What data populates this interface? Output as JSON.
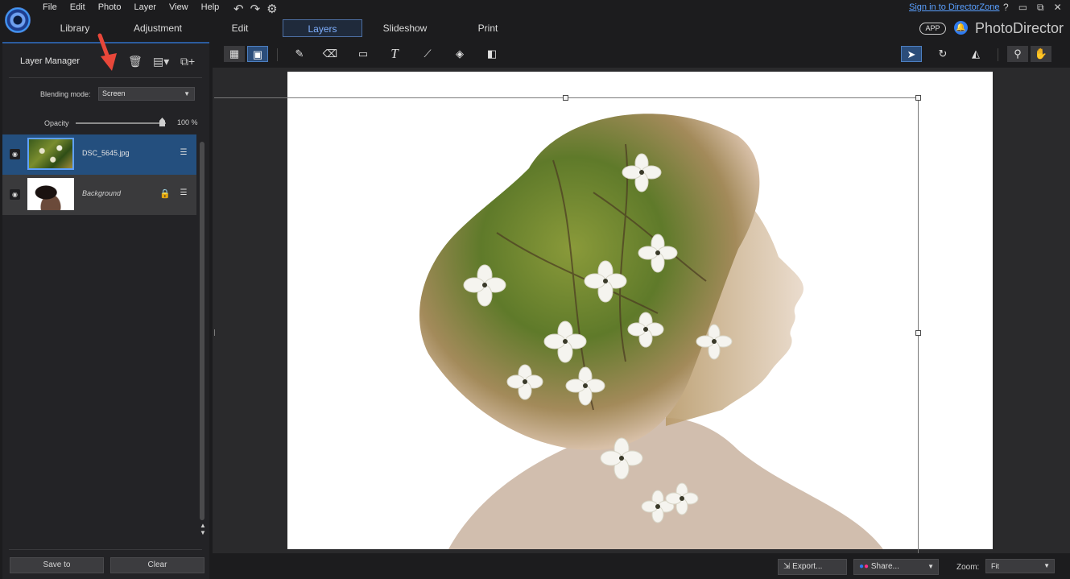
{
  "menu": [
    "File",
    "Edit",
    "Photo",
    "Layer",
    "View",
    "Help"
  ],
  "quick_actions": {
    "undo": "↶",
    "redo": "↷",
    "settings": "⚙"
  },
  "tabs": [
    {
      "label": "Library"
    },
    {
      "label": "Adjustment"
    },
    {
      "label": "Edit"
    },
    {
      "label": "Layers"
    },
    {
      "label": "Slideshow"
    },
    {
      "label": "Print"
    }
  ],
  "active_tab": "Layers",
  "header": {
    "signin": "Sign in to DirectorZone",
    "help": "?",
    "minimize": "▭",
    "restore": "⧉",
    "close": "✕",
    "app_badge": "APP",
    "product_name": "PhotoDirector"
  },
  "layer_manager": {
    "title": "Layer Manager",
    "blending_label": "Blending mode:",
    "blending_value": "Screen",
    "opacity_label": "Opacity",
    "opacity_value": "100 %",
    "opacity_level": 1.0,
    "layers": [
      {
        "name": "DSC_5645.jpg",
        "selected": true,
        "locked": false
      },
      {
        "name": "Background",
        "selected": false,
        "locked": true
      }
    ],
    "save_label": "Save to",
    "clear_label": "Clear"
  },
  "toolbar_icons": [
    "compare-view-icon",
    "single-view-icon",
    "brush-icon",
    "eraser-icon",
    "rectangle-icon",
    "text-icon",
    "clone-icon",
    "fill-icon",
    "gradient-icon",
    "select-icon",
    "rotate-icon",
    "flip-icon",
    "zoom-icon",
    "hand-icon"
  ],
  "bottom": {
    "export_label": "Export...",
    "share_label": "Share...",
    "zoom_label": "Zoom:",
    "zoom_value": "Fit"
  },
  "colors": {
    "accent": "#4d7fc0",
    "selected_layer": "#244f7e",
    "annotation_arrow": "#e8473a"
  }
}
